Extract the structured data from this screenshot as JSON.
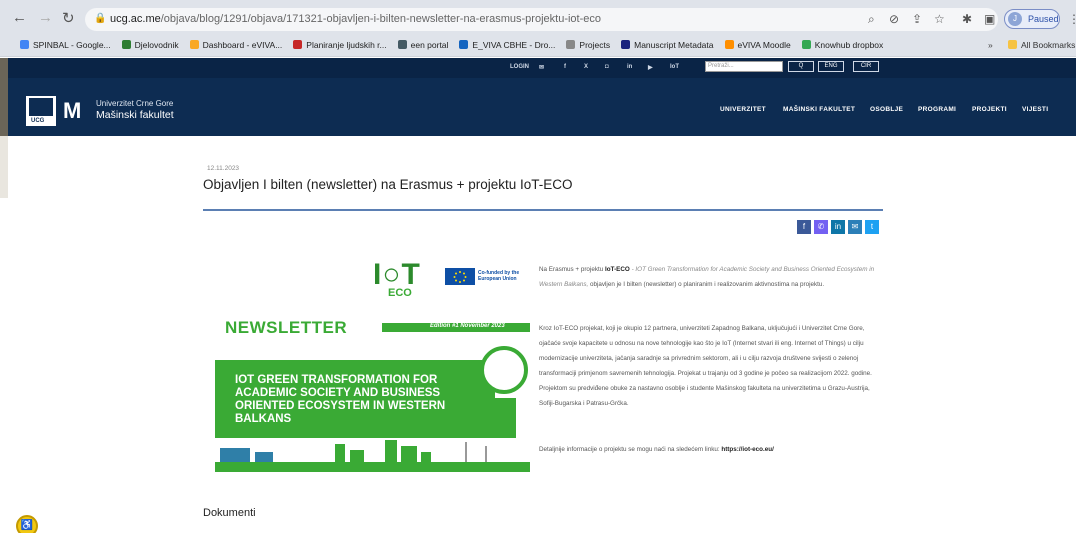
{
  "browser": {
    "url_host": "ucg.ac.me",
    "url_path": "/objava/blog/1291/objava/171321-objavljen-i-bilten-newsletter-na-erasmus-projektu-iot-eco",
    "profile_initial": "J",
    "profile_status": "Paused",
    "bookmarks": [
      {
        "label": "SPINBAL - Google...",
        "color": "#4285f4"
      },
      {
        "label": "Djelovodnik",
        "color": "#2e7d32"
      },
      {
        "label": "Dashboard - eVIVA...",
        "color": "#f9a825"
      },
      {
        "label": "Planiranje ljudskih r...",
        "color": "#c62828"
      },
      {
        "label": "een portal",
        "color": "#455a64"
      },
      {
        "label": "E_VIVA CBHE - Dro...",
        "color": "#1565c0"
      },
      {
        "label": "Projects",
        "color": "#888888"
      },
      {
        "label": "Manuscript Metadata",
        "color": "#1a237e"
      },
      {
        "label": "eVIVA Moodle",
        "color": "#ff8f00"
      },
      {
        "label": "Knowhub dropbox",
        "color": "#34a853"
      }
    ],
    "bookmarks_more": "»",
    "all_bookmarks": "All Bookmarks"
  },
  "site": {
    "top_links": [
      "LOGIN"
    ],
    "search_placeholder": "Pretraži...",
    "lang_en": "ENG",
    "lang_cir": "ĆIR",
    "search_btn": "Q",
    "logo_abbr": "UCG",
    "university": "Univerzitet Crne Gore",
    "faculty": "Mašinski fakultet",
    "menu": [
      "UNIVERZITET",
      "MAŠINSKI FAKULTET",
      "OSOBLJE",
      "PROGRAMI",
      "PROJEKTI",
      "VIJESTI"
    ]
  },
  "article": {
    "date": "12.11.2023",
    "title": "Objavljen I bilten (newsletter) na Erasmus + projektu IoT-ECO",
    "share": [
      {
        "icon": "facebook-icon",
        "glyph": "f",
        "color": "#3b5998"
      },
      {
        "icon": "viber-icon",
        "glyph": "✆",
        "color": "#7360f2"
      },
      {
        "icon": "linkedin-icon",
        "glyph": "in",
        "color": "#0e76a8"
      },
      {
        "icon": "mail-icon",
        "glyph": "✉",
        "color": "#2c7fb8"
      },
      {
        "icon": "twitter-icon",
        "glyph": "t",
        "color": "#1da1f2"
      }
    ],
    "p1_a": "Na Erasmus + projektu ",
    "p1_b": "IoT-ECO",
    "p1_c": " - IOT Green Transformation for Academic Society and Business Oriented Ecosystem in Western Balkans,",
    "p1_d": " objavljen je I bilten (newsletter) o planiranim i realizovanim aktivnostima na projektu.",
    "p2": "Kroz IoT-ECO projekat, koji je okupio 12 partnera, univerziteti Zapadnog Balkana, uključujući i Univerzitet Crne Gore, ojačaće svoje kapacitete u odnosu na nove tehnologije kao što je IoT (Internet stvari ili eng. Internet of Things) u cilju modernizacije univerziteta, jačanja saradnje sa privrednim sektorom, ali i u cilju razvoja društvene svijesti o zelenoj transformaciji primjenom savremenih tehnologija. Projekat u trajanju od 3 godine je počeo sa realizacijom 2022. godine. Projektom su predviđene obuke za nastavno osoblje i studente Mašinskog fakulteta na univerzitetima u Grazu-Austrija, Sofiji-Bugarska i Patrasu-Grčka.",
    "p3_a": "Detaljnije informacije o projektu se mogu naći na sledećem linku: ",
    "p3_link": "https://iot-eco.eu/",
    "documents_heading": "Dokumenti"
  },
  "newsletter_image": {
    "logo_main": "I○T",
    "logo_sub": "ECO",
    "eu_text": "Co-funded by the European Union",
    "heading": "NEWSLETTER",
    "edition": "Edition #1 November 2023",
    "banner": "IOT GREEN TRANSFORMATION FOR ACADEMIC SOCIETY AND BUSINESS ORIENTED ECOSYSTEM IN WESTERN BALKANS"
  }
}
